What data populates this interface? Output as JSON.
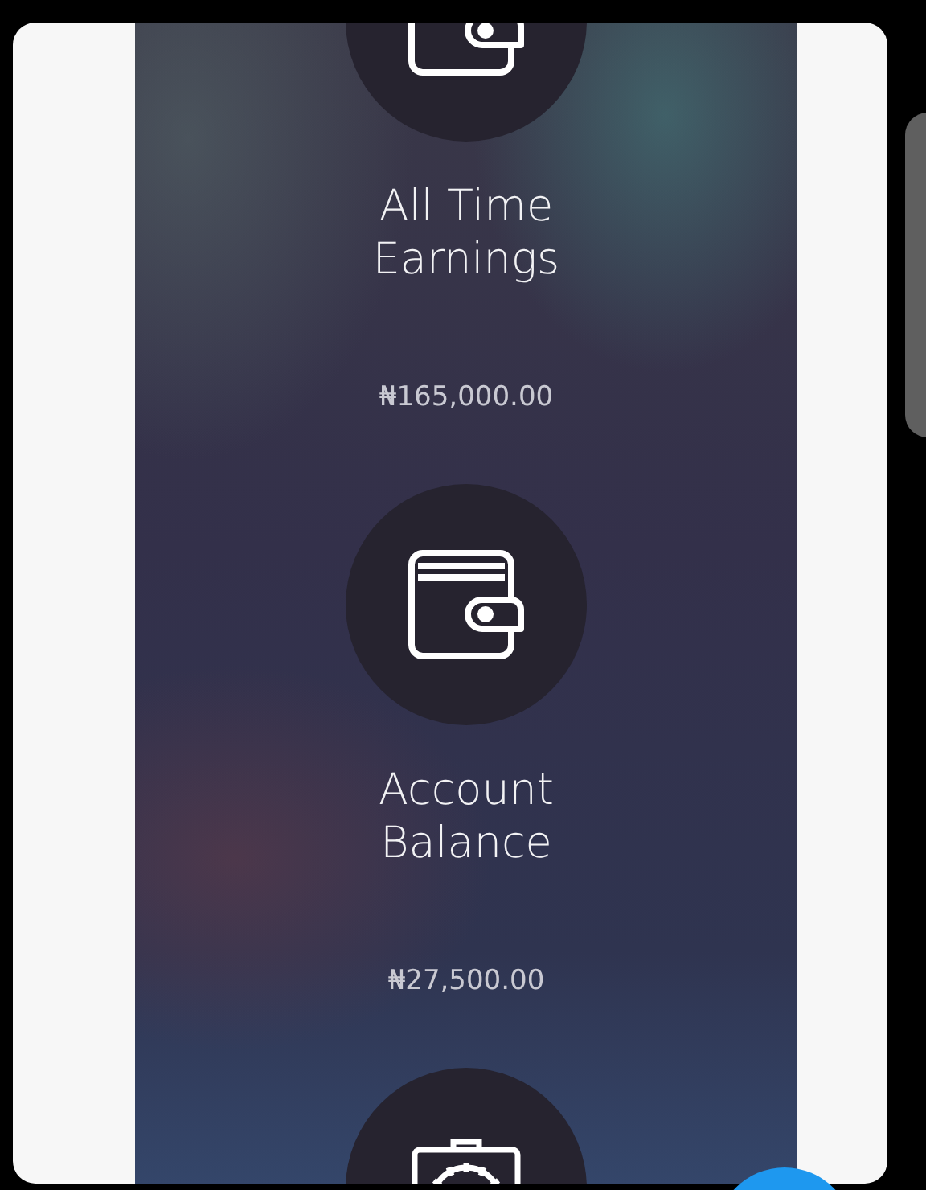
{
  "stats": [
    {
      "kind": "wallet",
      "title": "All Time Earnings",
      "amount": "₦165,000.00"
    },
    {
      "kind": "wallet",
      "title": "Account Balance",
      "amount": "₦27,500.00"
    },
    {
      "kind": "toolbox"
    }
  ]
}
